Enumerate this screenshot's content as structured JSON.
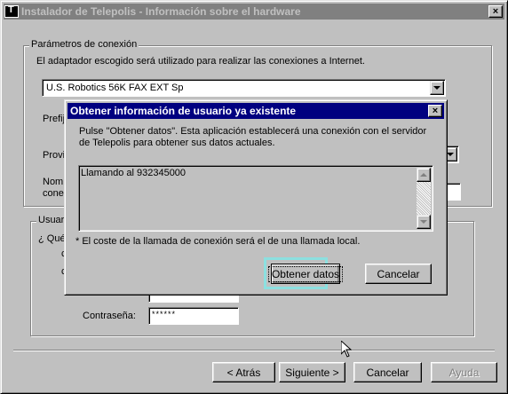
{
  "window": {
    "title": "Instalador de Telepolis - Información sobre el hardware",
    "close_label": "×"
  },
  "connection": {
    "legend": "Parámetros de conexión",
    "description": "El adaptador escogido será utilizado para realizar las conexiones a Internet.",
    "adapter_selected": "U.S. Robotics 56K FAX EXT Sp",
    "prefix_label": "Prefij",
    "province_label": "Provin",
    "name_label_line1": "Nomb",
    "name_label_line2": "conex"
  },
  "user": {
    "legend": "Usuari",
    "question": "¿ Qué",
    "row1_stub": "c",
    "row2_stub": "c",
    "password_label": "Contraseña:",
    "password_value": "******"
  },
  "footer": {
    "back": "< Atrás",
    "next": "Siguiente >",
    "cancel": "Cancelar",
    "help": "Ayuda"
  },
  "dialog": {
    "title": "Obtener información de usuario ya existente",
    "close_label": "×",
    "instructions": "Pulse \"Obtener datos\". Esta aplicación establecerá una conexión con el servidor de Telepolis para obtener sus datos actuales.",
    "log_text": "Llamando al 932345000",
    "note": "*  El coste de la llamada de conexión será el de una llamada local.",
    "get_data": "Obtener datos",
    "cancel": "Cancelar"
  },
  "colors": {
    "desktop": "#008080",
    "face": "#c0c0c0",
    "active_title": "#000080",
    "inactive_title": "#808080",
    "focus_highlight": "#8ce0e0"
  }
}
